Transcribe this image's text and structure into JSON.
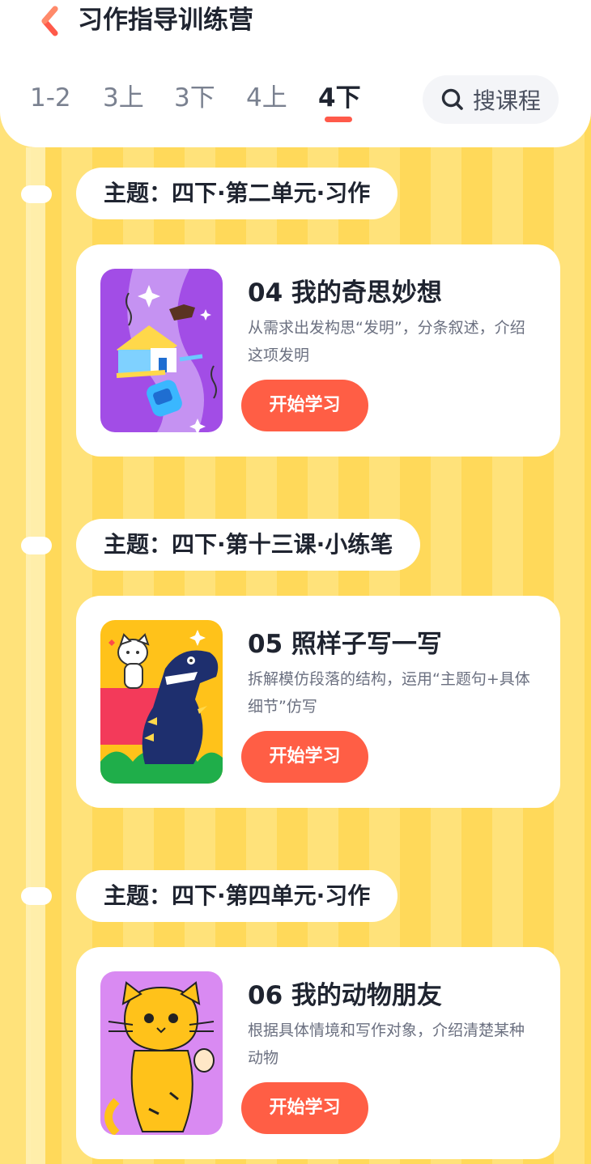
{
  "header": {
    "title": "习作指导训练营",
    "search_label": "搜课程"
  },
  "tabs": [
    {
      "label": "1-2"
    },
    {
      "label": "3上"
    },
    {
      "label": "3下"
    },
    {
      "label": "4上"
    },
    {
      "label": "4下",
      "active": true
    }
  ],
  "topics": [
    {
      "label": "主题：四下·第二单元·习作"
    },
    {
      "label": "主题：四下·第十三课·小练笔"
    },
    {
      "label": "主题：四下·第四单元·习作"
    }
  ],
  "lessons": [
    {
      "title": "04 我的奇思妙想",
      "desc": "从需求出发构思“发明”，分条叙述，介绍这项发明",
      "button": "开始学习"
    },
    {
      "title": "05 照样子写一写",
      "desc": "拆解模仿段落的结构，运用“主题句+具体细节”仿写",
      "button": "开始学习"
    },
    {
      "title": "06 我的动物朋友",
      "desc": "根据具体情境和写作对象，介绍清楚某种动物",
      "button": "开始学习"
    }
  ],
  "colors": {
    "accent": "#ff5e45",
    "tab_indicator": "#ff5a4a",
    "background_yellow": "#ffe27a"
  }
}
